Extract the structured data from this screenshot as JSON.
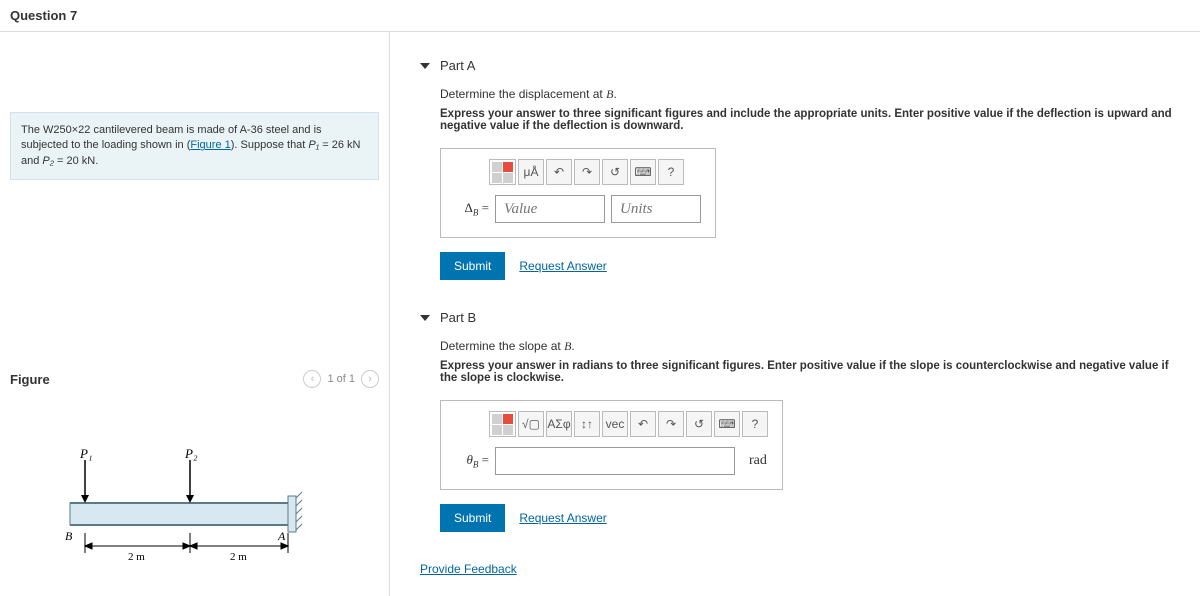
{
  "header": {
    "title": "Question 7"
  },
  "prompt": {
    "pre": "The W250×22 cantilevered beam is made of A-36 steel and is subjected to the loading shown in (",
    "link": "Figure 1",
    "post": "). Suppose that ",
    "p1_name": "P₁",
    "p1_val": " = 26 kN",
    "and": " and ",
    "p2_name": "P₂",
    "p2_val": " = 20 kN."
  },
  "figure": {
    "title": "Figure",
    "nav": "1 of 1",
    "labels": {
      "P1": "P₁",
      "P2": "P₂",
      "B": "B",
      "A": "A",
      "d1": "2 m",
      "d2": "2 m"
    }
  },
  "partA": {
    "title": "Part A",
    "question_pre": "Determine the displacement at ",
    "question_var": "B",
    "question_post": ".",
    "instruction": "Express your answer to three significant figures and include the appropriate units. Enter positive value if the deflection is upward and negative value if the deflection is downward.",
    "label": "Δ_B =",
    "value_ph": "Value",
    "units_ph": "Units",
    "tb": {
      "mu": "μÅ",
      "undo": "↶",
      "redo": "↷",
      "reset": "↺",
      "kbd": "⌨",
      "help": "?"
    }
  },
  "partB": {
    "title": "Part B",
    "question_pre": "Determine the slope at ",
    "question_var": "B",
    "question_post": ".",
    "instruction": "Express your answer in radians to three significant figures. Enter positive value if the slope is counterclockwise and negative value if the slope is clockwise.",
    "label": "θ_B =",
    "unit": "rad",
    "tb": {
      "sqrt": "√▢",
      "sigma": "ΑΣφ",
      "arrows": "↕↑",
      "vec": "vec",
      "undo": "↶",
      "redo": "↷",
      "reset": "↺",
      "kbd": "⌨",
      "help": "?"
    }
  },
  "buttons": {
    "submit": "Submit",
    "request": "Request Answer",
    "feedback": "Provide Feedback"
  }
}
